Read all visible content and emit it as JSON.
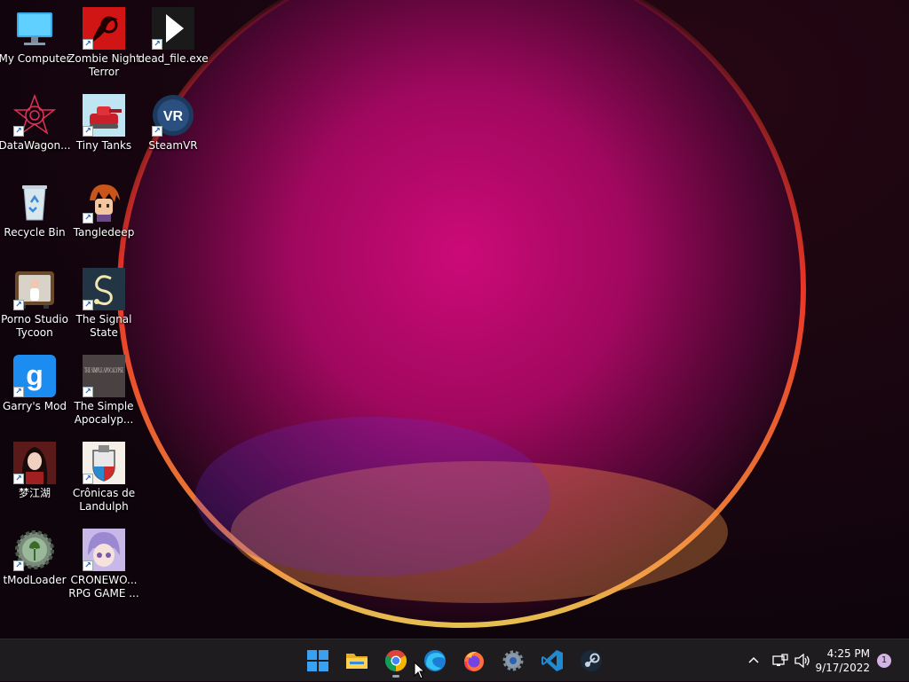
{
  "desktop": {
    "icons": [
      {
        "label": "My Computer",
        "icon": "computer-icon"
      },
      {
        "label": "Zombie Night Terror",
        "icon": "zombie-night-terror-icon"
      },
      {
        "label": "dead_file.exe",
        "icon": "dead-file-icon"
      },
      {
        "label": "DataWagon...",
        "icon": "datawagon-icon"
      },
      {
        "label": "Tiny Tanks",
        "icon": "tiny-tanks-icon"
      },
      {
        "label": "SteamVR",
        "icon": "steamvr-icon"
      },
      {
        "label": "Recycle Bin",
        "icon": "recycle-bin-icon"
      },
      {
        "label": "Tangledeep",
        "icon": "tangledeep-icon"
      },
      {
        "label": "Porno Studio Tycoon",
        "icon": "porno-studio-tycoon-icon"
      },
      {
        "label": "The Signal State",
        "icon": "signal-state-icon"
      },
      {
        "label": "Garry's Mod",
        "icon": "garrys-mod-icon"
      },
      {
        "label": "The Simple Apocalyp...",
        "icon": "simple-apocalypse-icon"
      },
      {
        "label": "梦江湖",
        "icon": "meng-jianghu-icon"
      },
      {
        "label": "Crônicas de Landulph",
        "icon": "cronicas-de-landulph-icon"
      },
      {
        "label": "tModLoader",
        "icon": "tmodloader-icon"
      },
      {
        "label": "CRONEWO... RPG GAME ...",
        "icon": "cronewo-rpg-icon"
      }
    ],
    "art_texts": {
      "steamvr": "VR",
      "simple_apocalypse": "THE SIMPLE APOCALYPSE",
      "garrys_mod": "g"
    },
    "wallpaper_colors": [
      "#e0107a",
      "#ff3d2a",
      "#ffd35a",
      "#140510"
    ]
  },
  "taskbar": {
    "pinned": [
      {
        "name": "start-button",
        "icon": "windows-logo-icon"
      },
      {
        "name": "file-explorer-button",
        "icon": "folder-icon"
      },
      {
        "name": "chrome-button",
        "icon": "chrome-icon",
        "active": true
      },
      {
        "name": "edge-button",
        "icon": "edge-icon"
      },
      {
        "name": "firefox-button",
        "icon": "firefox-icon"
      },
      {
        "name": "settings-button",
        "icon": "gear-icon"
      },
      {
        "name": "vscode-button",
        "icon": "vscode-icon"
      },
      {
        "name": "steam-button",
        "icon": "steam-icon"
      }
    ],
    "tray": {
      "overflow_icon": "chevron-up-icon",
      "network_icon": "network-icon",
      "volume_icon": "volume-icon",
      "time": "4:25 PM",
      "date": "9/17/2022",
      "notification_count": "1"
    }
  }
}
